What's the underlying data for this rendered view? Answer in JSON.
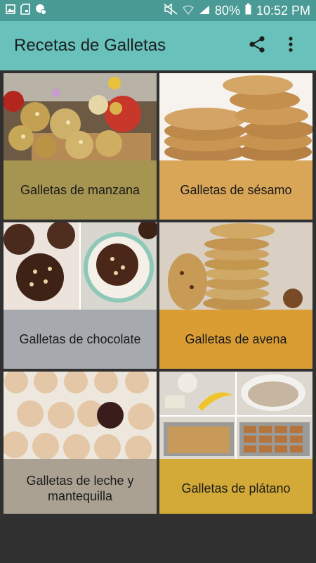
{
  "status_bar": {
    "battery_percent": "80%",
    "time": "10:52 PM",
    "icons": [
      "image-icon",
      "sd-card-icon",
      "security-icon",
      "mute-icon",
      "wifi-icon",
      "signal-icon",
      "battery-icon"
    ]
  },
  "app_bar": {
    "title": "Recetas de Galletas",
    "actions": [
      "share-icon",
      "more-vert-icon"
    ]
  },
  "recipes": [
    {
      "label": "Galletas de manzana",
      "color": "#a59551"
    },
    {
      "label": "Galletas de sésamo",
      "color": "#d9a557"
    },
    {
      "label": "Galletas de chocolate",
      "color": "#a6a9ad"
    },
    {
      "label": "Galletas de avena",
      "color": "#d99d34"
    },
    {
      "label": "Galletas de leche y mantequilla",
      "color": "#aaa192"
    },
    {
      "label": "Galletas de plátano",
      "color": "#d3aa38"
    }
  ]
}
